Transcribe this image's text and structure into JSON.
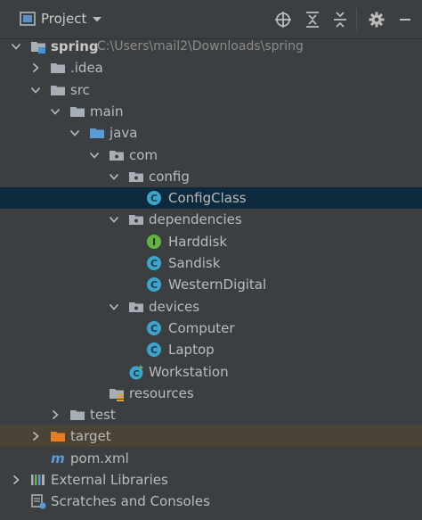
{
  "header": {
    "title": "Project"
  },
  "tree": [
    {
      "label": "spring",
      "path": "C:\\Users\\mail2\\Downloads\\spring",
      "indent": 0,
      "chev": "down",
      "icon": "module-folder",
      "bold": true
    },
    {
      "label": ".idea",
      "indent": 1,
      "chev": "right",
      "icon": "folder"
    },
    {
      "label": "src",
      "indent": 1,
      "chev": "down",
      "icon": "folder"
    },
    {
      "label": "main",
      "indent": 2,
      "chev": "down",
      "icon": "folder"
    },
    {
      "label": "java",
      "indent": 3,
      "chev": "down",
      "icon": "source-folder"
    },
    {
      "label": "com",
      "indent": 4,
      "chev": "down",
      "icon": "package"
    },
    {
      "label": "config",
      "indent": 5,
      "chev": "down",
      "icon": "package"
    },
    {
      "label": "ConfigClass",
      "indent": 6,
      "chev": "",
      "icon": "class",
      "selected": true
    },
    {
      "label": "dependencies",
      "indent": 5,
      "chev": "down",
      "icon": "package"
    },
    {
      "label": "Harddisk",
      "indent": 6,
      "chev": "",
      "icon": "interface"
    },
    {
      "label": "Sandisk",
      "indent": 6,
      "chev": "",
      "icon": "class"
    },
    {
      "label": "WesternDigital",
      "indent": 6,
      "chev": "",
      "icon": "class"
    },
    {
      "label": "devices",
      "indent": 5,
      "chev": "down",
      "icon": "package"
    },
    {
      "label": "Computer",
      "indent": 6,
      "chev": "",
      "icon": "class"
    },
    {
      "label": "Laptop",
      "indent": 6,
      "chev": "",
      "icon": "class"
    },
    {
      "label": "Workstation",
      "indent": 5,
      "chev": "",
      "icon": "main-class"
    },
    {
      "label": "resources",
      "indent": 4,
      "chev": "",
      "icon": "resources-folder"
    },
    {
      "label": "test",
      "indent": 2,
      "chev": "right",
      "icon": "folder"
    },
    {
      "label": "target",
      "indent": 1,
      "chev": "right",
      "icon": "excluded-folder",
      "excluded": true
    },
    {
      "label": "pom.xml",
      "indent": 1,
      "chev": "",
      "icon": "maven"
    },
    {
      "label": "External Libraries",
      "indent": 0,
      "chev": "right",
      "icon": "libraries"
    },
    {
      "label": "Scratches and Consoles",
      "indent": 0,
      "chev": "",
      "icon": "scratches"
    }
  ],
  "colors": {
    "background": "#3c3f41",
    "selected": "#0d293e",
    "excluded": "#4a4336",
    "class_icon": "#3fa4c9",
    "interface_icon": "#62b543",
    "folder": "#a7aeb5",
    "source_folder": "#5b9bd5",
    "excluded_folder": "#e67e22"
  }
}
